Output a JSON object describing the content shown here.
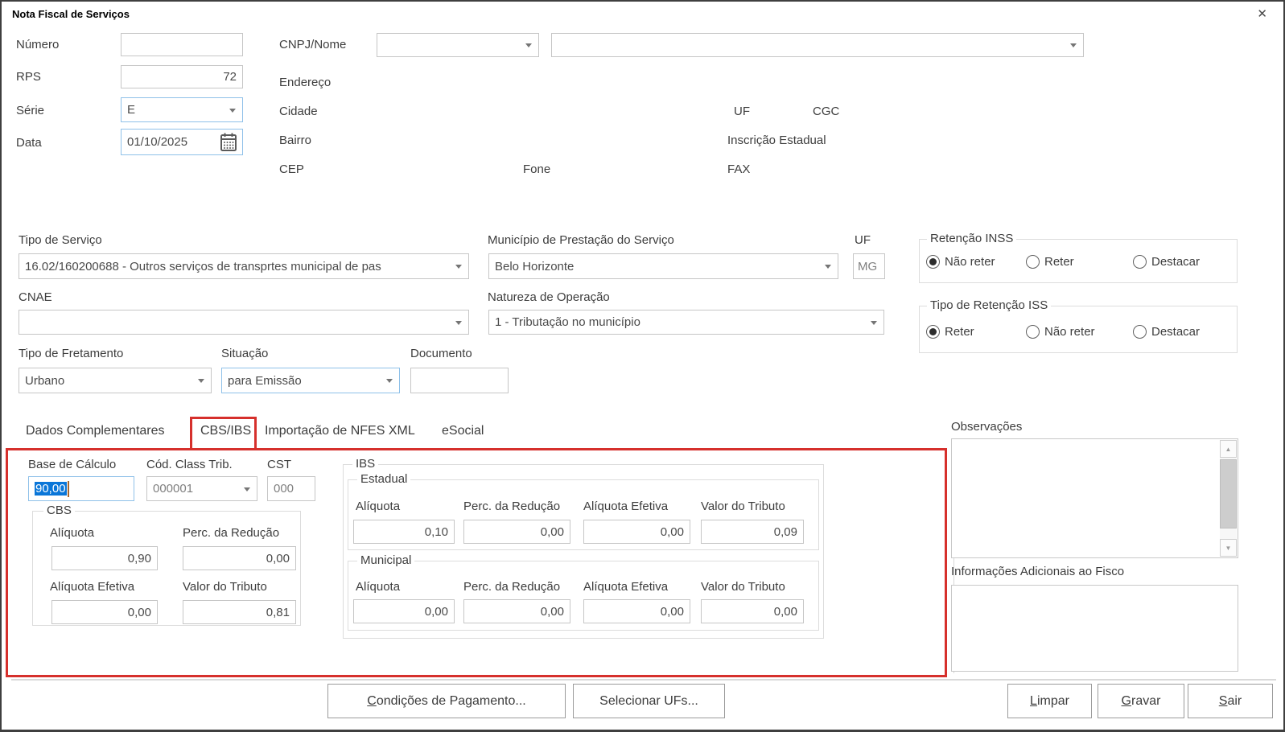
{
  "window": {
    "title": "Nota Fiscal de Serviços",
    "close_glyph": "✕"
  },
  "header": {
    "numero_label": "Número",
    "numero_value": "",
    "rps_label": "RPS",
    "rps_value": "72",
    "serie_label": "Série",
    "serie_value": "E",
    "data_label": "Data",
    "data_value": "01/10/2025",
    "cnpj_nome_label": "CNPJ/Nome",
    "cnpj_value": "",
    "nome_value": "",
    "endereco_label": "Endereço",
    "cidade_label": "Cidade",
    "uf_label": "UF",
    "cgc_label": "CGC",
    "bairro_label": "Bairro",
    "inscricao_estadual_label": "Inscrição Estadual",
    "cep_label": "CEP",
    "fone_label": "Fone",
    "fax_label": "FAX"
  },
  "service": {
    "tipo_servico_label": "Tipo de Serviço",
    "tipo_servico_value": "16.02/160200688 - Outros serviços de transprtes municipal de pas",
    "municipio_label": "Município de Prestação do Serviço",
    "municipio_value": "Belo Horizonte",
    "uf_label": "UF",
    "uf_value": "MG",
    "cnae_label": "CNAE",
    "cnae_value": "",
    "natureza_label": "Natureza de Operação",
    "natureza_value": "1 - Tributação no município",
    "fretamento_label": "Tipo de Fretamento",
    "fretamento_value": "Urbano",
    "situacao_label": "Situação",
    "situacao_value": "para Emissão",
    "documento_label": "Documento",
    "documento_value": ""
  },
  "retencao_inss": {
    "title": "Retenção INSS",
    "options": [
      {
        "label": "Não reter",
        "selected": true
      },
      {
        "label": "Reter",
        "selected": false
      },
      {
        "label": "Destacar",
        "selected": false
      }
    ]
  },
  "retencao_iss": {
    "title": "Tipo de Retenção ISS",
    "options": [
      {
        "label": "Reter",
        "selected": true
      },
      {
        "label": "Não reter",
        "selected": false
      },
      {
        "label": "Destacar",
        "selected": false
      }
    ]
  },
  "tabs": [
    {
      "label": "Dados Complementares",
      "active": false
    },
    {
      "label": "CBS/IBS",
      "active": true
    },
    {
      "label": "Importação de NFES XML",
      "active": false
    },
    {
      "label": "eSocial",
      "active": false
    }
  ],
  "cbs_ibs": {
    "base_calculo_label": "Base de Cálculo",
    "base_calculo_value": "90,00",
    "cod_class_trib_label": "Cód. Class Trib.",
    "cod_class_trib_value": "000001",
    "cst_label": "CST",
    "cst_value": "000",
    "cbs": {
      "title": "CBS",
      "aliquota_label": "Alíquota",
      "aliquota_value": "0,90",
      "perc_reducao_label": "Perc. da Redução",
      "perc_reducao_value": "0,00",
      "aliquota_efetiva_label": "Alíquota Efetiva",
      "aliquota_efetiva_value": "0,00",
      "valor_tributo_label": "Valor do Tributo",
      "valor_tributo_value": "0,81"
    },
    "ibs": {
      "title": "IBS",
      "estadual": {
        "title": "Estadual",
        "aliquota_label": "Alíquota",
        "aliquota_value": "0,10",
        "perc_reducao_label": "Perc. da Redução",
        "perc_reducao_value": "0,00",
        "aliquota_efetiva_label": "Alíquota Efetiva",
        "aliquota_efetiva_value": "0,00",
        "valor_tributo_label": "Valor do Tributo",
        "valor_tributo_value": "0,09"
      },
      "municipal": {
        "title": "Municipal",
        "aliquota_label": "Alíquota",
        "aliquota_value": "0,00",
        "perc_reducao_label": "Perc. da Redução",
        "perc_reducao_value": "0,00",
        "aliquota_efetiva_label": "Alíquota Efetiva",
        "aliquota_efetiva_value": "0,00",
        "valor_tributo_label": "Valor do Tributo",
        "valor_tributo_value": "0,00"
      }
    }
  },
  "right_panel": {
    "observacoes_label": "Observações",
    "observacoes_value": "",
    "info_fisco_label": "Informações Adicionais ao Fisco",
    "info_fisco_value": "",
    "scroll_up_glyph": "▲",
    "scroll_down_glyph": "▼"
  },
  "footer": {
    "condicoes": {
      "mnemonic": "C",
      "rest": "ondições de Pagamento..."
    },
    "selecionar": {
      "mnemonic": "",
      "rest": "Selecionar UFs..."
    },
    "limpar": {
      "mnemonic": "L",
      "rest": "impar"
    },
    "gravar": {
      "mnemonic": "G",
      "rest": "ravar"
    },
    "sair": {
      "mnemonic": "S",
      "rest": "air"
    }
  },
  "colors": {
    "highlight_red": "#d6302c",
    "selection_blue": "#0a76d8",
    "focus_border": "#8fc1e9"
  }
}
